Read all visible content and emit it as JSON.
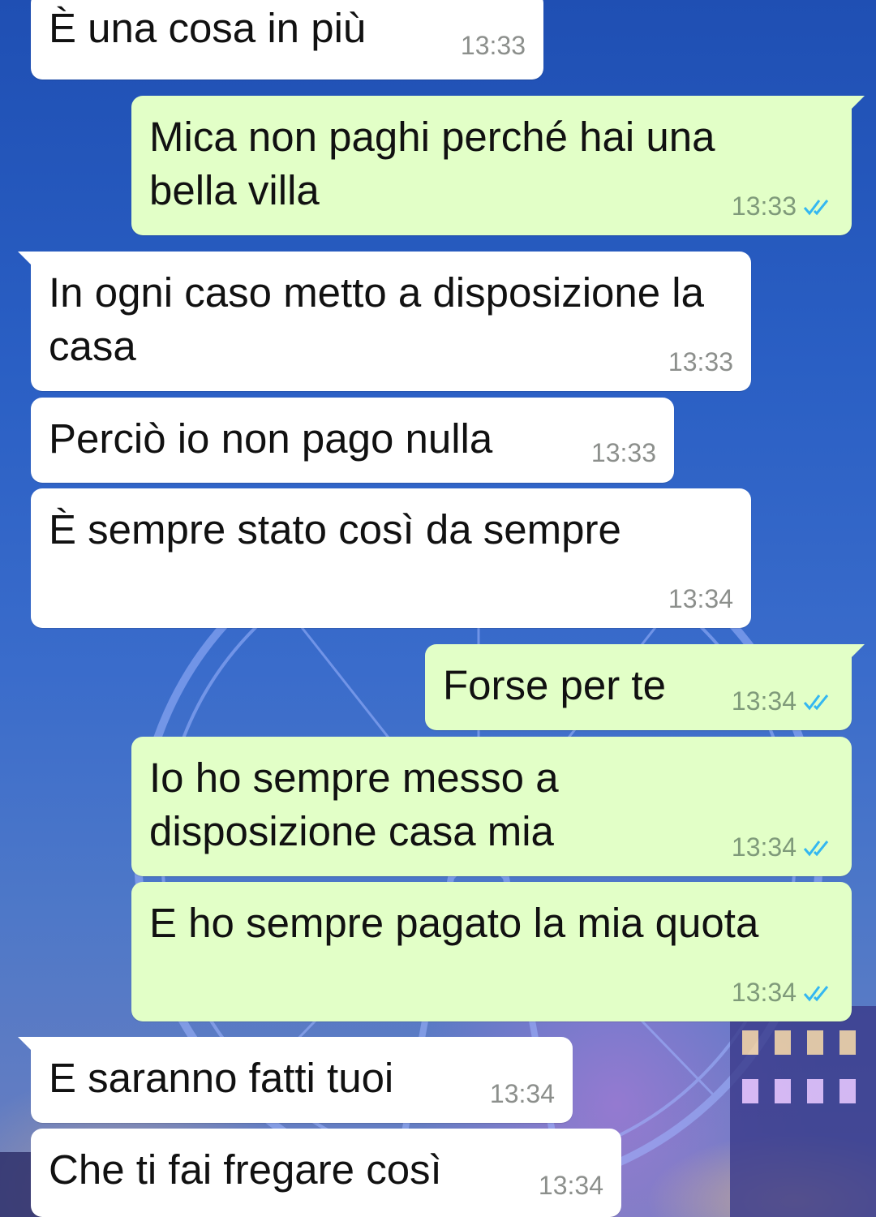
{
  "conversation": {
    "messages": [
      {
        "dir": "in",
        "text": "È una cosa in più",
        "time": "13:33"
      },
      {
        "dir": "out",
        "text": "Mica non paghi perché hai una bella villa",
        "time": "13:33",
        "status": "read"
      },
      {
        "dir": "in",
        "text": "In ogni caso metto a disposizione la casa",
        "time": "13:33"
      },
      {
        "dir": "in",
        "text": "Perciò io non pago nulla",
        "time": "13:33"
      },
      {
        "dir": "in",
        "text": "È sempre stato così da sempre",
        "time": "13:34"
      },
      {
        "dir": "out",
        "text": "Forse per te",
        "time": "13:34",
        "status": "read"
      },
      {
        "dir": "out",
        "text": "Io ho sempre messo a disposizione casa mia",
        "time": "13:34",
        "status": "read"
      },
      {
        "dir": "out",
        "text": "E ho sempre pagato la mia quota",
        "time": "13:34",
        "status": "read"
      },
      {
        "dir": "in",
        "text": "E saranno fatti tuoi",
        "time": "13:34"
      },
      {
        "dir": "in",
        "text": "Che ti fai fregare così",
        "time": "13:34"
      }
    ]
  },
  "colors": {
    "incoming_bubble": "#ffffff",
    "outgoing_bubble": "#e2ffc7",
    "read_tick": "#34b7f1",
    "timestamp": "#8c8f8c"
  },
  "icons": {
    "read_receipt": "double-check-icon"
  }
}
